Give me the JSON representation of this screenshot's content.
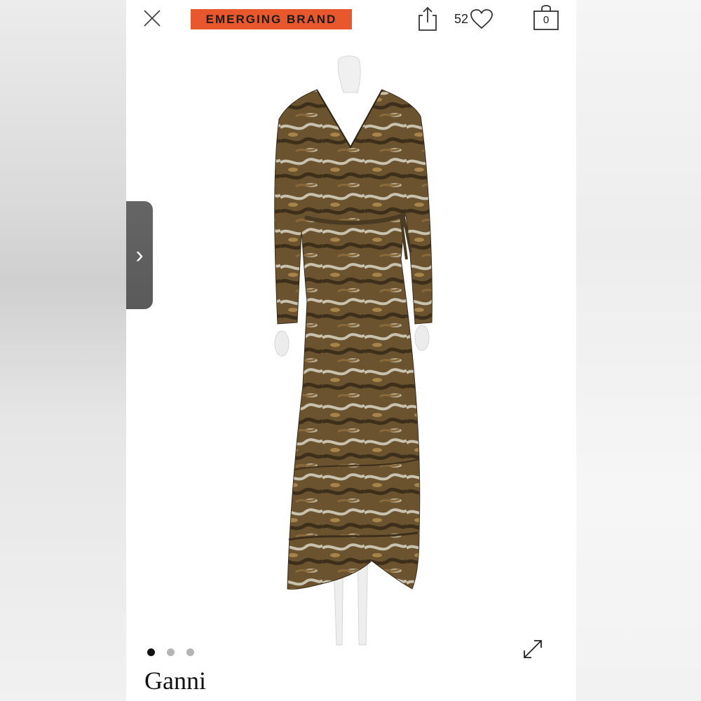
{
  "header": {
    "badge_label": "EMERGING BRAND",
    "likes_count": "52",
    "cart_count": "0",
    "icons": [
      "close-icon",
      "share-icon",
      "heart-icon",
      "shopping-bag-icon"
    ]
  },
  "gallery": {
    "next_arrow": "›",
    "dots_total": 3,
    "active_dot": 1,
    "image_subject": "patterned wrap maxi dress on mannequin"
  },
  "product": {
    "brand": "Ganni"
  },
  "colors": {
    "badge": "#e8582c",
    "arrow_tab": "#5f5f5f",
    "dress_dark": "#4a3a22",
    "dress_mid": "#8a6a3a",
    "dress_light": "#c9c2ae"
  }
}
